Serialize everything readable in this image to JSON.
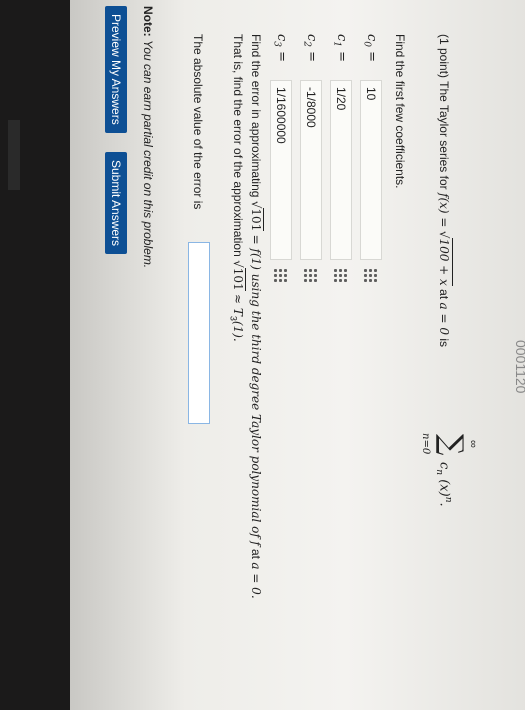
{
  "header_fragment": "0001120",
  "problem": {
    "points": "(1 point)",
    "intro_a": "The Taylor series for",
    "fx": "f(x) =",
    "radicand": "100 + x",
    "intro_b": "at",
    "a_eq": "a = 0",
    "intro_c": "is",
    "sum_top": "∞",
    "sum_bottom": "n=0",
    "series_term": "c",
    "series_sub": "n",
    "series_rest": "(x)",
    "series_sup": "n",
    "period": ".",
    "coeff_prompt": "Find the first few coefficients.",
    "error_line1_a": "Find the error in approximating",
    "error_line1_rad": "101",
    "error_line1_b": "= f(1) using the third degree Taylor polynomial of",
    "error_line1_f": "f",
    "error_line1_c": "at",
    "error_line1_a0": "a = 0.",
    "error_line2_a": "That is, find the error of the approximation",
    "error_line2_rad": "101",
    "error_line2_b": "≈ T",
    "error_line2_sub": "3",
    "error_line2_c": "(1).",
    "abs_label": "The absolute value of the error is",
    "abs_value": ""
  },
  "coefficients": [
    {
      "label": "c",
      "sub": "0",
      "eq": "=",
      "value": "10"
    },
    {
      "label": "c",
      "sub": "1",
      "eq": "=",
      "value": "1/20"
    },
    {
      "label": "c",
      "sub": "2",
      "eq": "=",
      "value": "-1/8000"
    },
    {
      "label": "c",
      "sub": "3",
      "eq": "=",
      "value": "1/1600000"
    }
  ],
  "note": {
    "bold": "Note:",
    "text": "You can earn partial credit on this problem."
  },
  "buttons": {
    "preview": "Preview My Answers",
    "submit": "Submit Answers"
  }
}
